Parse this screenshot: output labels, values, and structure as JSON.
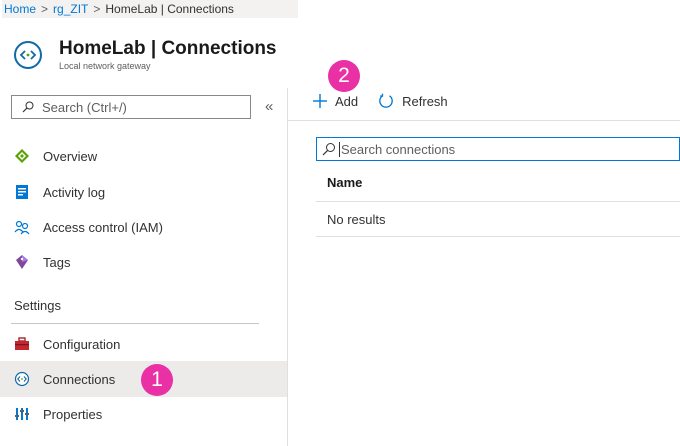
{
  "breadcrumb": {
    "items": [
      "Home",
      "rg_ZIT",
      "HomeLab | Connections"
    ],
    "separator": ">"
  },
  "header": {
    "title": "HomeLab | Connections",
    "subtitle": "Local network gateway",
    "icon": "connections-icon"
  },
  "sidebar": {
    "search_placeholder": "Search (Ctrl+/)",
    "collapse_label": "«",
    "items": [
      {
        "label": "Overview",
        "icon": "overview-icon"
      },
      {
        "label": "Activity log",
        "icon": "activity-log-icon"
      },
      {
        "label": "Access control (IAM)",
        "icon": "iam-icon"
      },
      {
        "label": "Tags",
        "icon": "tag-icon"
      }
    ],
    "settings_header": "Settings",
    "settings_items": [
      {
        "label": "Configuration",
        "icon": "toolbox-icon"
      },
      {
        "label": "Connections",
        "icon": "connections-icon",
        "selected": true
      },
      {
        "label": "Properties",
        "icon": "properties-icon"
      }
    ]
  },
  "toolbar": {
    "add_label": "Add",
    "refresh_label": "Refresh"
  },
  "main": {
    "search_placeholder": "Search connections",
    "column_header": "Name",
    "empty_text": "No results"
  },
  "callouts": {
    "step1": "1",
    "step2": "2"
  },
  "colors": {
    "accent": "#0078d4",
    "callout": "#e930a4",
    "selected_bg": "#edebe9"
  }
}
